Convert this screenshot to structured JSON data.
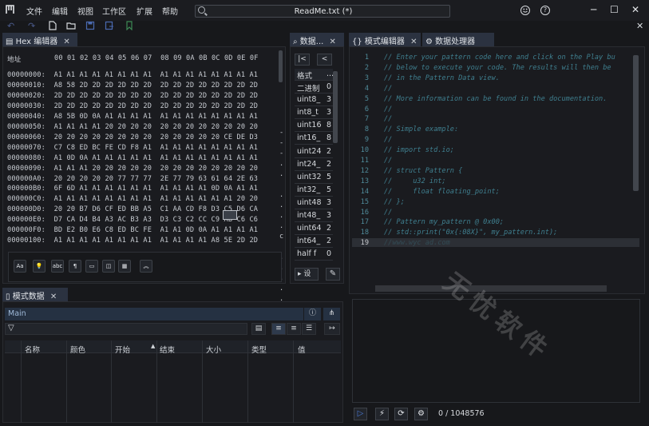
{
  "app": {
    "logo": "logo-icon",
    "menu": [
      "文件",
      "编辑",
      "视图",
      "工作区",
      "扩展",
      "帮助"
    ],
    "document_title": "ReadMe.txt (*)",
    "window_controls": [
      "minimize-icon",
      "maximize-icon",
      "close-icon"
    ]
  },
  "hex_editor": {
    "tab_label": "Hex 编辑器",
    "header_label": "地址",
    "header_columns": "00 01 02 03 04 05 06 07  08 09 0A 0B 0C 0D 0E 0F",
    "rows": [
      "00000000:  A1 A1 A1 A1 A1 A1 A1 A1  A1 A1 A1 A1 A1 A1 A1 A1",
      "00000010:  A8 58 2D 2D 2D 2D 2D 2D  2D 2D 2D 2D 2D 2D 2D 2D",
      "00000020:  2D 2D 2D 2D 2D 2D 2D 2D  2D 2D 2D 2D 2D 2D 2D 2D",
      "00000030:  2D 2D 2D 2D 2D 2D 2D 2D  2D 2D 2D 2D 2D 2D 2D 2D",
      "00000040:  A8 5B 0D 0A A1 A1 A1 A1  A1 A1 A1 A1 A1 A1 A1 A1",
      "00000050:  A1 A1 A1 A1 20 20 20 20  20 20 20 20 20 20 20 20",
      "00000060:  20 20 20 20 20 20 20 20  20 20 20 20 20 CE DE D3",
      "00000070:  C7 C8 ED BC FE CD F8 A1  A1 A1 A1 A1 A1 A1 A1 A1",
      "00000080:  A1 0D 0A A1 A1 A1 A1 A1  A1 A1 A1 A1 A1 A1 A1 A1",
      "00000090:  A1 A1 A1 20 20 20 20 20  20 20 20 20 20 20 20 20",
      "000000A0:  20 20 20 20 20 77 77 77  2E 77 79 63 61 64 2E 63",
      "000000B0:  6F 6D A1 A1 A1 A1 A1 A1  A1 A1 A1 A1 0D 0A A1 A1",
      "000000C0:  A1 A1 A1 A1 A1 A1 A1 A1  A1 A1 A1 A1 A1 A1 20 20",
      "000000D0:  20 20 B7 D6 CF ED BB A5  C1 AA CD F8 D3 C5 D6 CA",
      "000000E0:  D7 CA D4 B4 A3 AC B3 A3  D3 C3 C2 CC C9 AB C6 C6",
      "000000F0:  BD E2 B0 E6 C8 ED BC FE  A1 A1 0D 0A A1 A1 A1 A1",
      "00000100:  A1 A1 A1 A1 A1 A1 A1 A1  A1 A1 A1 A1 A8 5E 2D 2D"
    ],
    "ascii_fragments": [
      "-",
      "-",
      "-",
      ".",
      ".",
      ".",
      ".",
      ".",
      ".",
      "c",
      ".",
      ".",
      ".",
      ".",
      "."
    ],
    "footer_buttons": [
      "Aa",
      "lightbulb-icon",
      "abc",
      "paragraph-icon",
      "comment-icon",
      "map-icon",
      "table-icon",
      "collapse-up-icon"
    ]
  },
  "data_inspector": {
    "tab_label": "数据...",
    "header_name": "格式",
    "header_value": "...",
    "rows": [
      {
        "name": "二进制",
        "value": "0"
      },
      {
        "name": "uint8_",
        "value": "3"
      },
      {
        "name": "int8_t",
        "value": "3"
      },
      {
        "name": "uint16",
        "value": "8"
      },
      {
        "name": "int16_",
        "value": "8"
      },
      {
        "name": "uint24",
        "value": "2"
      },
      {
        "name": "int24_",
        "value": "2"
      },
      {
        "name": "uint32",
        "value": "5"
      },
      {
        "name": "int32_",
        "value": "5"
      },
      {
        "name": "uint48",
        "value": "3"
      },
      {
        "name": "int48_",
        "value": "3"
      },
      {
        "name": "uint64",
        "value": "2"
      },
      {
        "name": "int64_",
        "value": "2"
      },
      {
        "name": "half f",
        "value": "0"
      }
    ],
    "settings_label": "设"
  },
  "pattern_editor": {
    "tab_label": "模式编辑器",
    "tab2_label": "数据处理器",
    "lines": [
      "// Enter your pattern code here and click on the Play bu",
      "// below to execute your code. The results will then be",
      "// in the Pattern Data view.",
      "//",
      "// More information can be found in the documentation.",
      "//",
      "//",
      "// Simple example:",
      "//",
      "// import std.io;",
      "//",
      "// struct Pattern {",
      "//     u32 int;",
      "//     float floating_point;",
      "// };",
      "//",
      "// Pattern my_pattern @ 0x00;",
      "// std::print(\"0x{:08X}\", my_pattern.int);",
      "//www.wyc ad.com"
    ],
    "line_numbers": [
      "1",
      "2",
      "3",
      "4",
      "5",
      "6",
      "7",
      "8",
      "9",
      "10",
      "11",
      "12",
      "13",
      "14",
      "15",
      "16",
      "17",
      "18",
      "19"
    ],
    "progress": "0 / 1048576"
  },
  "pattern_data": {
    "tab_label": "模式数据",
    "main_tab": "Main",
    "columns": [
      "名称",
      "颜色",
      "开始",
      "结束",
      "大小",
      "类型",
      "值"
    ]
  },
  "watermark": "无忧软件"
}
